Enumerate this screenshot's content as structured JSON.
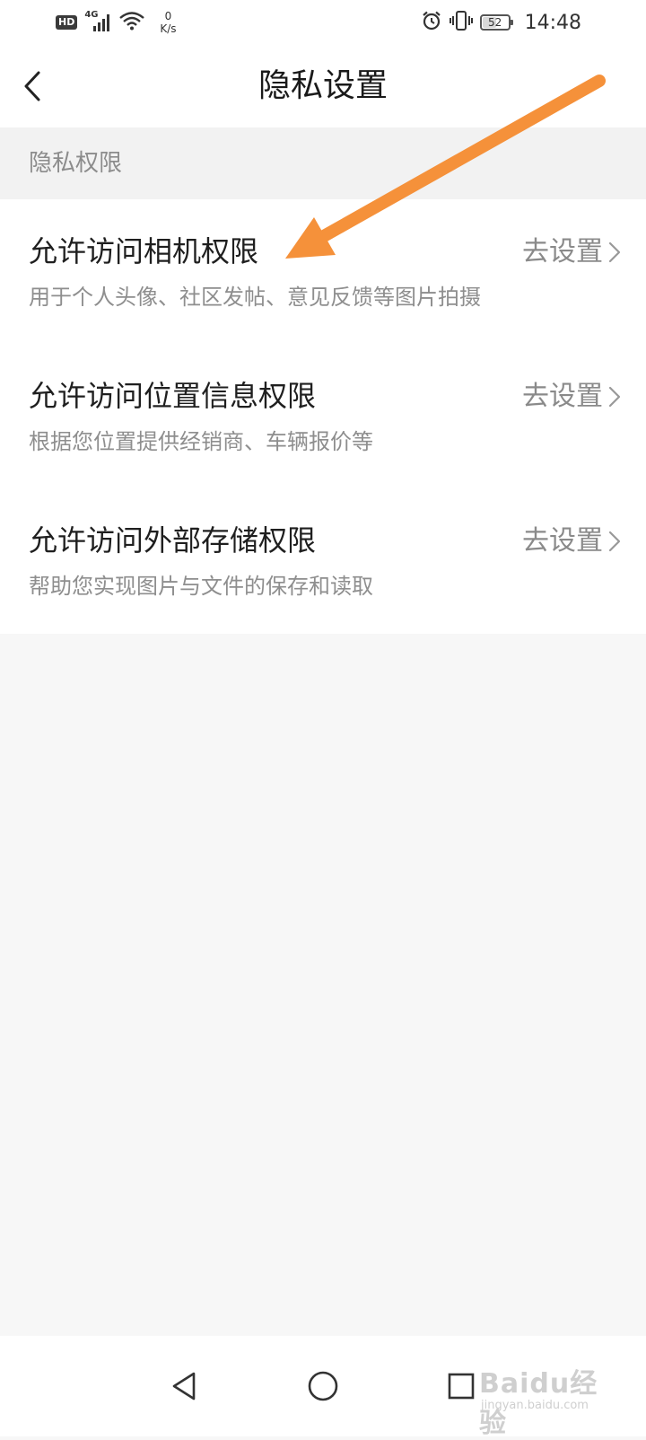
{
  "status_bar": {
    "hd": "HD",
    "network": "4G",
    "speed_value": "0",
    "speed_unit": "K/s",
    "battery": "52",
    "battery_level": 0.52,
    "time": "14:48"
  },
  "header": {
    "title": "隐私设置"
  },
  "section": {
    "label": "隐私权限"
  },
  "items": [
    {
      "title": "允许访问相机权限",
      "description": "用于个人头像、社区发帖、意见反馈等图片拍摄",
      "action": "去设置"
    },
    {
      "title": "允许访问位置信息权限",
      "description": "根据您位置提供经销商、车辆报价等",
      "action": "去设置"
    },
    {
      "title": "允许访问外部存储权限",
      "description": "帮助您实现图片与文件的保存和读取",
      "action": "去设置"
    }
  ],
  "annotation": {
    "color": "#f5913a"
  },
  "watermark": {
    "text": "Baidu经验",
    "sub": "jingyan.baidu.com"
  },
  "icons": {
    "back": "chevron-left-icon",
    "chevron": "chevron-right-icon",
    "nav_back": "triangle-back-icon",
    "nav_home": "circle-home-icon",
    "nav_recent": "square-recent-icon"
  }
}
